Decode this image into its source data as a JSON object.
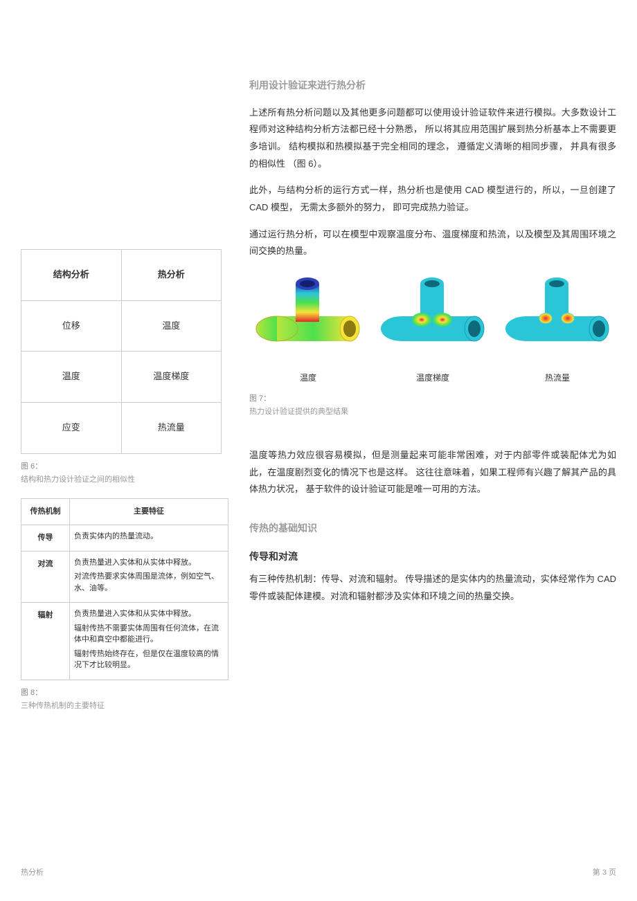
{
  "header": {
    "section1": "利用设计验证来进行热分析"
  },
  "paragraphs": {
    "p1": "上述所有热分析问题以及其他更多问题都可以使用设计验证软件来进行模拟。大多数设计工程师对这种结构分析方法都已经十分熟悉， 所以将其应用范围扩展到热分析基本上不需要更多培训。 结构模拟和热模拟基于完全相同的理念， 遵循定义清晰的相同步骤， 并具有很多的相似性 （图 6）。",
    "p2": "此外，与结构分析的运行方式一样，热分析也是使用 CAD 模型进行的，所以，一旦创建了 CAD 模型， 无需太多额外的努力， 即可完成热力验证。",
    "p3": "通过运行热分析，可以在模型中观察温度分布、温度梯度和热流，以及模型及其周围环境之间交换的热量。",
    "p4": "温度等热力效应很容易模拟，但是测量起来可能非常困难，对于内部零件或装配体尤为如此，在温度剧烈变化的情况下也是这样。 这往往意味着，如果工程师有兴趣了解其产品的具体热力状况， 基于软件的设计验证可能是唯一可用的方法。",
    "p5": "有三种传热机制：传导、对流和辐射。 传导描述的是实体内的热量流动，实体经常作为 CAD 零件或装配体建模。对流和辐射都涉及实体和环境之间的热量交换。"
  },
  "table6": {
    "headers": {
      "c1": "结构分析",
      "c2": "热分析"
    },
    "rows": [
      {
        "c1": "位移",
        "c2": "温度"
      },
      {
        "c1": "温度",
        "c2": "温度梯度"
      },
      {
        "c1": "应变",
        "c2": "热流量"
      }
    ]
  },
  "fig6": {
    "label": "图 6：",
    "caption": "结构和热力设计验证之间的相似性"
  },
  "fig7": {
    "labels": {
      "a": "温度",
      "b": "温度梯度",
      "c": "热流量"
    },
    "label": "图 7：",
    "caption": "热力设计验证提供的典型结果"
  },
  "section2": {
    "title": "传热的基础知识",
    "sub": "传导和对流"
  },
  "table8": {
    "headers": {
      "c1": "传热机制",
      "c2": "主要特征"
    },
    "rows": [
      {
        "mech": "传导",
        "feat": [
          "负责实体内的热量流动。"
        ]
      },
      {
        "mech": "对流",
        "feat": [
          "负责热量进入实体和从实体中释放。",
          "对流传热要求实体周围是流体，例如空气、水、油等。"
        ]
      },
      {
        "mech": "辐射",
        "feat": [
          "负责热量进入实体和从实体中释放。",
          "辐射传热不需要实体周围有任何流体，在流体中和真空中都能进行。",
          "辐射传热始终存在，但是仅在温度较高的情况下才比较明显。"
        ]
      }
    ]
  },
  "fig8": {
    "label": "图 8：",
    "caption": "三种传热机制的主要特征"
  },
  "footer": {
    "left": "热分析",
    "right": "第 3 页"
  }
}
